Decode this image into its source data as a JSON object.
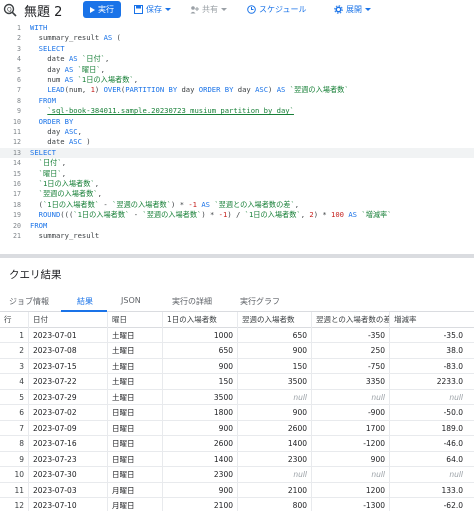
{
  "toolbar": {
    "title": "無題 2",
    "run_label": "実行",
    "save_label": "保存",
    "share_label": "共有",
    "schedule_label": "スケジュール",
    "deploy_label": "展開"
  },
  "editor": {
    "lines": [
      {
        "n": "1",
        "html": "<span class=\"kw\">WITH</span>"
      },
      {
        "n": "2",
        "html": "  summary_result <span class=\"kw\">AS</span> ("
      },
      {
        "n": "3",
        "html": "  <span class=\"kw\">SELECT</span>"
      },
      {
        "n": "4",
        "html": "    date <span class=\"kw\">AS</span> <span class=\"str\">`日付`</span>,"
      },
      {
        "n": "5",
        "html": "    day <span class=\"kw\">AS</span> <span class=\"str\">`曜日`</span>,"
      },
      {
        "n": "6",
        "html": "    num <span class=\"kw\">AS</span> <span class=\"str\">`1日の入場者数`</span>,"
      },
      {
        "n": "7",
        "html": "    <span class=\"fn\">LEAD</span>(num, <span class=\"num\">1</span>) <span class=\"kw\">OVER</span>(<span class=\"kw\">PARTITION BY</span> day <span class=\"kw\">ORDER BY</span> day <span class=\"kw\">ASC</span>) <span class=\"kw\">AS</span> <span class=\"str\">`翌週の入場者数`</span>"
      },
      {
        "n": "8",
        "html": "  <span class=\"kw\">FROM</span>"
      },
      {
        "n": "9",
        "html": "    <span class=\"link\">`sql-book-384011.sample.20230723_musium_partition_by_day`</span>"
      },
      {
        "n": "10",
        "html": "  <span class=\"kw\">ORDER BY</span>"
      },
      {
        "n": "11",
        "html": "    day <span class=\"kw\">ASC</span>,"
      },
      {
        "n": "12",
        "html": "    date <span class=\"kw\">ASC</span> )"
      },
      {
        "n": "13",
        "html": "<span class=\"kw\">SELECT</span>"
      },
      {
        "n": "14",
        "html": "  <span class=\"str\">`日付`</span>,"
      },
      {
        "n": "15",
        "html": "  <span class=\"str\">`曜日`</span>,"
      },
      {
        "n": "16",
        "html": "  <span class=\"str\">`1日の入場者数`</span>,"
      },
      {
        "n": "17",
        "html": "  <span class=\"str\">`翌週の入場者数`</span>,"
      },
      {
        "n": "18",
        "html": "  (<span class=\"str\">`1日の入場者数`</span> - <span class=\"str\">`翌週の入場者数`</span>) * <span class=\"num\">-1</span> <span class=\"kw\">AS</span> <span class=\"str\">`翌週との入場者数の差`</span>,"
      },
      {
        "n": "19",
        "html": "  <span class=\"fn\">ROUND</span>(((<span class=\"str\">`1日の入場者数`</span> - <span class=\"str\">`翌週の入場者数`</span>) * <span class=\"num\">-1</span>) / <span class=\"str\">`1日の入場者数`</span>, <span class=\"num\">2</span>) * <span class=\"num\">100</span> <span class=\"kw\">AS</span> <span class=\"str\">`増減率`</span>"
      },
      {
        "n": "20",
        "html": "<span class=\"kw\">FROM</span>"
      },
      {
        "n": "21",
        "html": "  summary_result"
      }
    ]
  },
  "results": {
    "title": "クエリ結果",
    "tabs": [
      "ジョブ情報",
      "結果",
      "JSON",
      "実行の詳細",
      "実行グラフ"
    ],
    "active_tab": "結果",
    "columns": [
      "行",
      "日付",
      "曜日",
      "1日の入場者数",
      "翌週の入場者数",
      "翌週との入場者数の差",
      "増減率"
    ],
    "rows": [
      [
        "1",
        "2023-07-01",
        "土曜日",
        "1000",
        "650",
        "-350",
        "-35.0"
      ],
      [
        "2",
        "2023-07-08",
        "土曜日",
        "650",
        "900",
        "250",
        "38.0"
      ],
      [
        "3",
        "2023-07-15",
        "土曜日",
        "900",
        "150",
        "-750",
        "-83.0"
      ],
      [
        "4",
        "2023-07-22",
        "土曜日",
        "150",
        "3500",
        "3350",
        "2233.0"
      ],
      [
        "5",
        "2023-07-29",
        "土曜日",
        "3500",
        "null",
        "null",
        "null"
      ],
      [
        "6",
        "2023-07-02",
        "日曜日",
        "1800",
        "900",
        "-900",
        "-50.0"
      ],
      [
        "7",
        "2023-07-09",
        "日曜日",
        "900",
        "2600",
        "1700",
        "189.0"
      ],
      [
        "8",
        "2023-07-16",
        "日曜日",
        "2600",
        "1400",
        "-1200",
        "-46.0"
      ],
      [
        "9",
        "2023-07-23",
        "日曜日",
        "1400",
        "2300",
        "900",
        "64.0"
      ],
      [
        "10",
        "2023-07-30",
        "日曜日",
        "2300",
        "null",
        "null",
        "null"
      ],
      [
        "11",
        "2023-07-03",
        "月曜日",
        "900",
        "2100",
        "1200",
        "133.0"
      ],
      [
        "12",
        "2023-07-10",
        "月曜日",
        "2100",
        "800",
        "-1300",
        "-62.0"
      ]
    ]
  }
}
